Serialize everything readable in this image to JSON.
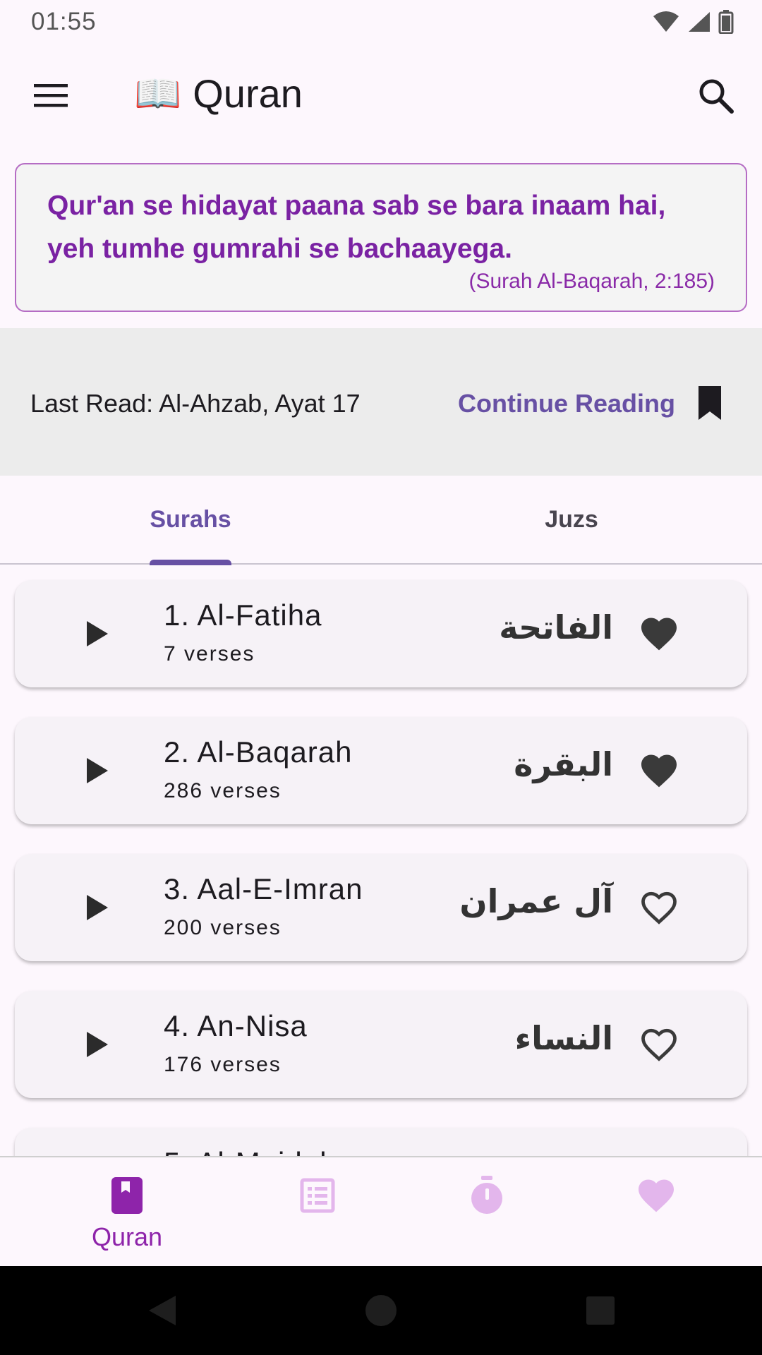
{
  "status_bar": {
    "time": "01:55"
  },
  "app_bar": {
    "emoji": "📖",
    "title": "Quran"
  },
  "quote": {
    "text": "Qur'an se hidayat paana sab se bara inaam hai, yeh tumhe gumrahi se bachaayega.",
    "reference": "(Surah Al-Baqarah, 2:185)"
  },
  "last_read": {
    "text": "Last Read: Al-Ahzab, Ayat 17",
    "continue_label": "Continue Reading"
  },
  "tabs": [
    {
      "label": "Surahs",
      "selected": true
    },
    {
      "label": "Juzs",
      "selected": false
    }
  ],
  "surahs": [
    {
      "name": "1. Al-Fatiha",
      "verses": "7 verses",
      "arabic": "الفاتحة",
      "favorite": true
    },
    {
      "name": "2. Al-Baqarah",
      "verses": "286 verses",
      "arabic": "البقرة",
      "favorite": true
    },
    {
      "name": "3. Aal-E-Imran",
      "verses": "200 verses",
      "arabic": "آل عمران",
      "favorite": false
    },
    {
      "name": "4. An-Nisa",
      "verses": "176 verses",
      "arabic": "النساء",
      "favorite": false
    },
    {
      "name": "5. Al-Maidah",
      "verses": "",
      "arabic": "",
      "favorite": false
    }
  ],
  "bottom_nav": [
    {
      "label": "Quran",
      "icon": "book-icon",
      "active": true
    },
    {
      "label": "",
      "icon": "list-icon",
      "active": false
    },
    {
      "label": "",
      "icon": "timer-icon",
      "active": false
    },
    {
      "label": "",
      "icon": "heart-icon",
      "active": false
    }
  ],
  "colors": {
    "primary": "#6750a4",
    "accent_purple": "#8e24aa",
    "quote_text": "#7a22a3",
    "quote_border": "#b56cc4",
    "background": "#fdf7fd"
  }
}
